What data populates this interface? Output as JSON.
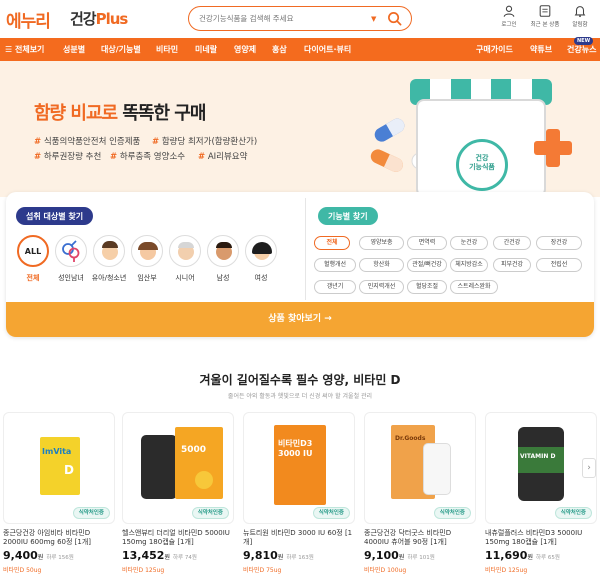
{
  "brand": {
    "logo": "에누리",
    "sub_logo": "건강",
    "sub_logo_plus": "Plus"
  },
  "search": {
    "placeholder": "건강기능식품을 검색해 주세요"
  },
  "header_icons": [
    {
      "label": "로그인",
      "icon": "user-icon"
    },
    {
      "label": "최근 본 상품",
      "icon": "recent-icon"
    },
    {
      "label": "알림함",
      "icon": "bell-icon"
    }
  ],
  "nav": {
    "all": "전체보기",
    "items": [
      "성분별",
      "대상/기능별",
      "비타민",
      "미네랄",
      "영양제",
      "홍삼",
      "다이어트·뷰티"
    ],
    "right": [
      "구매가이드",
      "약튜브",
      "건강뉴스"
    ],
    "new_badge": "NEW"
  },
  "banner": {
    "headline_hl": "함량 비교로",
    "headline_rest": " 똑똑한 구매",
    "tags": [
      "식품의약품안전처 인증제품",
      "함량당 최저가(함량환산가)",
      "하루권장량 추천",
      "하루충족 영양소수",
      "AI리뷰요약"
    ],
    "store_badge": [
      "건강",
      "기능식품"
    ]
  },
  "filters": {
    "target_title": "섭취 대상별 찾기",
    "targets": [
      "전체",
      "성인남녀",
      "유아/청소년",
      "임산부",
      "시니어",
      "남성",
      "여성"
    ],
    "all_label": "ALL",
    "function_title": "기능별 찾기",
    "functions": [
      [
        "전체",
        "영양보충",
        "면역력",
        "눈건강",
        "간건강",
        "장건강"
      ],
      [
        "혈행개선",
        "항산화",
        "관절/뼈건강",
        "체지방감소",
        "피부건강",
        "전립선"
      ],
      [
        "갱년기",
        "인지력개선",
        "혈당조절",
        "스트레스완화"
      ]
    ],
    "find_button": "상품 찾아보기 →"
  },
  "section": {
    "title": "겨울이 길어질수록 필수 영양, 비타민 D",
    "subtitle": "줄어든 야외 활동과 햇빛으로 더 신경 써야 할 겨울철 관리"
  },
  "cert_label": "식약처인증",
  "products": [
    {
      "name": "종근당건강 아임비타 비타민D 2000IU 600mg 60정 [1개]",
      "price": "9,400",
      "won": "원",
      "unit": "하루 156원",
      "tag": "비타민D 50ug",
      "brand_text": "ImVita",
      "box_color": "#f4d22a"
    },
    {
      "name": "헬스앤뷰티 더리얼 비타민D 5000IU 150mg 180캡슐 [1개]",
      "price": "13,452",
      "won": "원",
      "unit": "하루 74원",
      "tag": "비타민D 125ug",
      "brand_text": "5000",
      "box_color": "#f5a623"
    },
    {
      "name": "뉴트리원 비타민D 3000 IU 60정 [1개]",
      "price": "9,810",
      "won": "원",
      "unit": "하루 163원",
      "tag": "비타민D 75ug",
      "brand_text": "비타민D3 3000 IU",
      "box_color": "#f28a1e"
    },
    {
      "name": "종근당건강 닥터굿스 비타민D 4000IU 츄어블 90정 [1개]",
      "price": "9,100",
      "won": "원",
      "unit": "하루 101원",
      "tag": "비타민D 100ug",
      "brand_text": "Dr.Goods",
      "box_color": "#f0a24a"
    },
    {
      "name": "내츄럴플러스 비타민D3 5000IU 150mg 180캡슐 [1개]",
      "price": "11,690",
      "won": "원",
      "unit": "하루 65원",
      "tag": "비타민D 125ug",
      "brand_text": "VITAMIN D",
      "box_color": "#2c2c2c"
    }
  ]
}
